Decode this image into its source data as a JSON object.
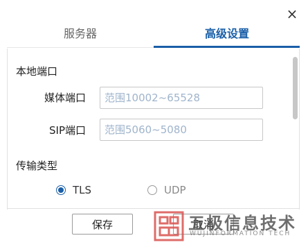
{
  "dialog": {
    "close_glyph": "×"
  },
  "tabs": [
    {
      "label": "服务器",
      "active": false
    },
    {
      "label": "高级设置",
      "active": true
    }
  ],
  "local_port": {
    "title": "本地端口",
    "media_port": {
      "label": "媒体端口",
      "value": "",
      "placeholder": "范围10002~65528"
    },
    "sip_port": {
      "label": "SIP端口",
      "value": "",
      "placeholder": "范围5060~5080"
    }
  },
  "transport": {
    "title": "传输类型",
    "options": [
      {
        "label": "TLS",
        "checked": true
      },
      {
        "label": "UDP",
        "checked": false
      }
    ]
  },
  "footer": {
    "save_label": "保存",
    "cancel_label": "取消"
  },
  "watermark": {
    "cn_text": "五极信息技术",
    "en_text": "WUJINFORMATION TECH"
  },
  "colors": {
    "accent": "#1a5fa8",
    "placeholder": "#9fb4cc",
    "watermark_logo": "#d9534f"
  }
}
